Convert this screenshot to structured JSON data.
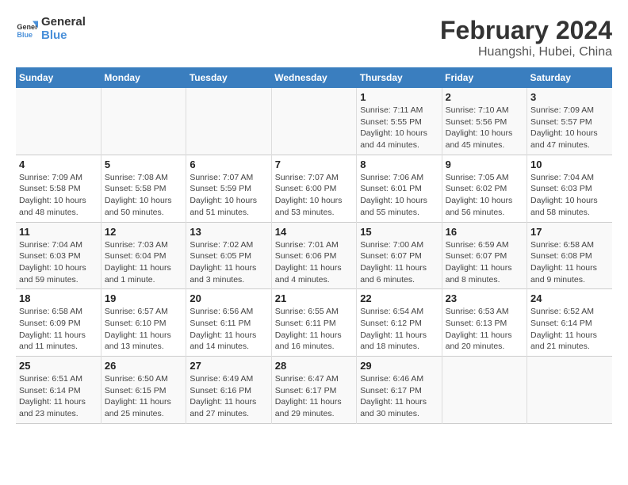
{
  "logo": {
    "line1": "General",
    "line2": "Blue"
  },
  "title": "February 2024",
  "subtitle": "Huangshi, Hubei, China",
  "weekdays": [
    "Sunday",
    "Monday",
    "Tuesday",
    "Wednesday",
    "Thursday",
    "Friday",
    "Saturday"
  ],
  "weeks": [
    [
      {
        "day": "",
        "text": ""
      },
      {
        "day": "",
        "text": ""
      },
      {
        "day": "",
        "text": ""
      },
      {
        "day": "",
        "text": ""
      },
      {
        "day": "1",
        "text": "Sunrise: 7:11 AM\nSunset: 5:55 PM\nDaylight: 10 hours and 44 minutes."
      },
      {
        "day": "2",
        "text": "Sunrise: 7:10 AM\nSunset: 5:56 PM\nDaylight: 10 hours and 45 minutes."
      },
      {
        "day": "3",
        "text": "Sunrise: 7:09 AM\nSunset: 5:57 PM\nDaylight: 10 hours and 47 minutes."
      }
    ],
    [
      {
        "day": "4",
        "text": "Sunrise: 7:09 AM\nSunset: 5:58 PM\nDaylight: 10 hours and 48 minutes."
      },
      {
        "day": "5",
        "text": "Sunrise: 7:08 AM\nSunset: 5:58 PM\nDaylight: 10 hours and 50 minutes."
      },
      {
        "day": "6",
        "text": "Sunrise: 7:07 AM\nSunset: 5:59 PM\nDaylight: 10 hours and 51 minutes."
      },
      {
        "day": "7",
        "text": "Sunrise: 7:07 AM\nSunset: 6:00 PM\nDaylight: 10 hours and 53 minutes."
      },
      {
        "day": "8",
        "text": "Sunrise: 7:06 AM\nSunset: 6:01 PM\nDaylight: 10 hours and 55 minutes."
      },
      {
        "day": "9",
        "text": "Sunrise: 7:05 AM\nSunset: 6:02 PM\nDaylight: 10 hours and 56 minutes."
      },
      {
        "day": "10",
        "text": "Sunrise: 7:04 AM\nSunset: 6:03 PM\nDaylight: 10 hours and 58 minutes."
      }
    ],
    [
      {
        "day": "11",
        "text": "Sunrise: 7:04 AM\nSunset: 6:03 PM\nDaylight: 10 hours and 59 minutes."
      },
      {
        "day": "12",
        "text": "Sunrise: 7:03 AM\nSunset: 6:04 PM\nDaylight: 11 hours and 1 minute."
      },
      {
        "day": "13",
        "text": "Sunrise: 7:02 AM\nSunset: 6:05 PM\nDaylight: 11 hours and 3 minutes."
      },
      {
        "day": "14",
        "text": "Sunrise: 7:01 AM\nSunset: 6:06 PM\nDaylight: 11 hours and 4 minutes."
      },
      {
        "day": "15",
        "text": "Sunrise: 7:00 AM\nSunset: 6:07 PM\nDaylight: 11 hours and 6 minutes."
      },
      {
        "day": "16",
        "text": "Sunrise: 6:59 AM\nSunset: 6:07 PM\nDaylight: 11 hours and 8 minutes."
      },
      {
        "day": "17",
        "text": "Sunrise: 6:58 AM\nSunset: 6:08 PM\nDaylight: 11 hours and 9 minutes."
      }
    ],
    [
      {
        "day": "18",
        "text": "Sunrise: 6:58 AM\nSunset: 6:09 PM\nDaylight: 11 hours and 11 minutes."
      },
      {
        "day": "19",
        "text": "Sunrise: 6:57 AM\nSunset: 6:10 PM\nDaylight: 11 hours and 13 minutes."
      },
      {
        "day": "20",
        "text": "Sunrise: 6:56 AM\nSunset: 6:11 PM\nDaylight: 11 hours and 14 minutes."
      },
      {
        "day": "21",
        "text": "Sunrise: 6:55 AM\nSunset: 6:11 PM\nDaylight: 11 hours and 16 minutes."
      },
      {
        "day": "22",
        "text": "Sunrise: 6:54 AM\nSunset: 6:12 PM\nDaylight: 11 hours and 18 minutes."
      },
      {
        "day": "23",
        "text": "Sunrise: 6:53 AM\nSunset: 6:13 PM\nDaylight: 11 hours and 20 minutes."
      },
      {
        "day": "24",
        "text": "Sunrise: 6:52 AM\nSunset: 6:14 PM\nDaylight: 11 hours and 21 minutes."
      }
    ],
    [
      {
        "day": "25",
        "text": "Sunrise: 6:51 AM\nSunset: 6:14 PM\nDaylight: 11 hours and 23 minutes."
      },
      {
        "day": "26",
        "text": "Sunrise: 6:50 AM\nSunset: 6:15 PM\nDaylight: 11 hours and 25 minutes."
      },
      {
        "day": "27",
        "text": "Sunrise: 6:49 AM\nSunset: 6:16 PM\nDaylight: 11 hours and 27 minutes."
      },
      {
        "day": "28",
        "text": "Sunrise: 6:47 AM\nSunset: 6:17 PM\nDaylight: 11 hours and 29 minutes."
      },
      {
        "day": "29",
        "text": "Sunrise: 6:46 AM\nSunset: 6:17 PM\nDaylight: 11 hours and 30 minutes."
      },
      {
        "day": "",
        "text": ""
      },
      {
        "day": "",
        "text": ""
      }
    ]
  ]
}
